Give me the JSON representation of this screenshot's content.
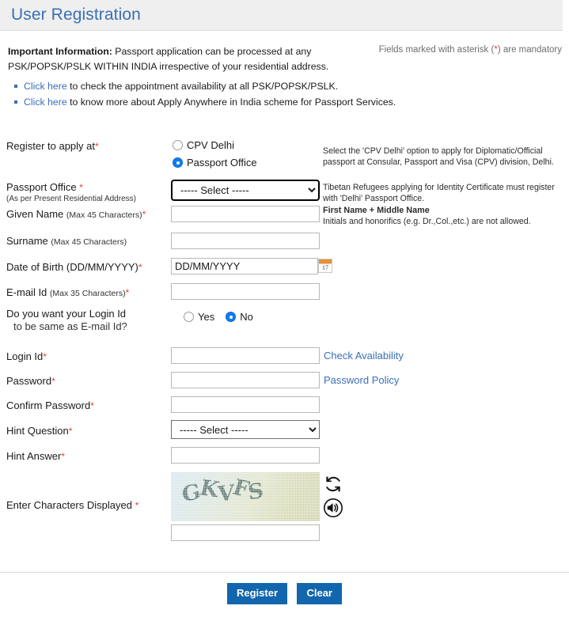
{
  "header": {
    "title": "User Registration",
    "mandatory_note_prefix": "Fields marked with asterisk (",
    "mandatory_note_asterisk": "*",
    "mandatory_note_suffix": ") are mandatory"
  },
  "important_info": {
    "label": "Important Information:",
    "text": " Passport application can be processed at any PSK/POPSK/PSLK WITHIN INDIA irrespective of your residential address.",
    "links": [
      {
        "link_text": "Click here",
        "rest": " to check the appointment availability at all PSK/POPSK/PSLK."
      },
      {
        "link_text": "Click here",
        "rest": " to know more about Apply Anywhere in India scheme for Passport Services."
      }
    ]
  },
  "form": {
    "register_at": {
      "label": "Register to apply at",
      "required": "*",
      "options": [
        {
          "label": "CPV Delhi",
          "selected": false
        },
        {
          "label": "Passport Office",
          "selected": true
        }
      ],
      "hint": "Select the 'CPV Delhi' option to apply for Diplomatic/Official passport at Consular, Passport and Visa (CPV) division, Delhi."
    },
    "passport_office": {
      "label": "Passport Office ",
      "required": "*",
      "sublabel": "(As per Present Residential Address)",
      "value": "----- Select -----",
      "hint": "Tibetan Refugees applying for Identity Certificate must register with 'Delhi' Passport Office."
    },
    "given_name": {
      "label": "Given Name ",
      "small": "(Max 45 Characters)",
      "required": "*",
      "value": "",
      "hint_bold": "First Name + Middle Name",
      "hint": "Initials and honorifics (e.g. Dr.,Col.,etc.) are not allowed."
    },
    "surname": {
      "label": "Surname ",
      "small": "(Max 45 Characters)",
      "value": ""
    },
    "dob": {
      "label": "Date of Birth (DD/MM/YYYY)",
      "required": "*",
      "value": "DD/MM/YYYY",
      "calendar_day": "17"
    },
    "email": {
      "label": "E-mail Id ",
      "small": "(Max 35 Characters)",
      "required": "*",
      "value": ""
    },
    "login_same_as_email": {
      "label_line1": "Do you want your Login Id",
      "label_line2": "to be same as E-mail Id?",
      "options": [
        {
          "label": "Yes",
          "selected": false
        },
        {
          "label": "No",
          "selected": true
        }
      ]
    },
    "login_id": {
      "label": "Login Id",
      "required": "*",
      "value": "",
      "side_link": "Check Availability"
    },
    "password": {
      "label": "Password",
      "required": "*",
      "value": "",
      "side_link": "Password Policy"
    },
    "confirm_password": {
      "label": "Confirm Password",
      "required": "*",
      "value": ""
    },
    "hint_question": {
      "label": "Hint Question",
      "required": "*",
      "value": "----- Select -----"
    },
    "hint_answer": {
      "label": "Hint Answer",
      "required": "*",
      "value": ""
    },
    "captcha": {
      "label": "Enter Characters Displayed ",
      "required": "*",
      "image_text": "GKVFS",
      "value": "",
      "refresh_icon": "refresh-icon",
      "audio_icon": "speaker-icon"
    }
  },
  "buttons": {
    "register": "Register",
    "clear": "Clear"
  },
  "colors": {
    "title": "#3a6fb5",
    "link": "#3a6fb5",
    "required": "#e8413c",
    "button": "#1266ad",
    "radio_selected": "#0d7ef0"
  }
}
